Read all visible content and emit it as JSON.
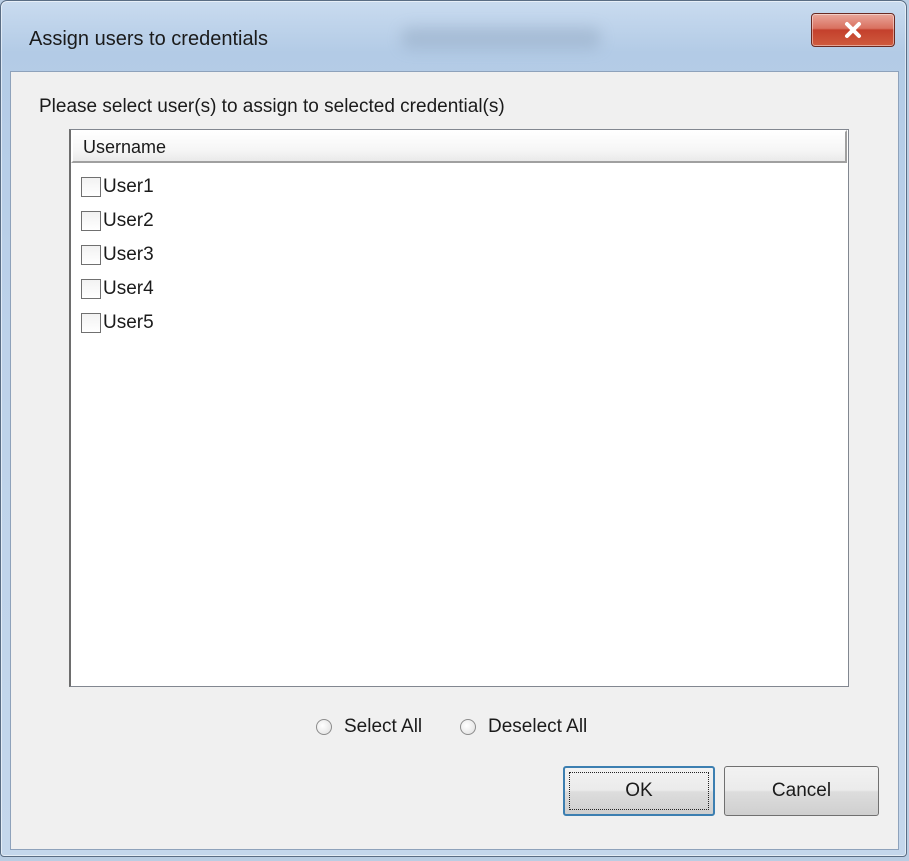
{
  "window": {
    "title": "Assign users to credentials"
  },
  "dialog": {
    "instruction": "Please select user(s) to assign to selected credential(s)",
    "list": {
      "column_header": "Username",
      "items": [
        {
          "label": "User1",
          "checked": false
        },
        {
          "label": "User2",
          "checked": false
        },
        {
          "label": "User3",
          "checked": false
        },
        {
          "label": "User4",
          "checked": false
        },
        {
          "label": "User5",
          "checked": false
        }
      ]
    },
    "radios": {
      "select_all": "Select All",
      "deselect_all": "Deselect All"
    },
    "buttons": {
      "ok": "OK",
      "cancel": "Cancel"
    }
  },
  "icons": {
    "close": "close-icon"
  }
}
